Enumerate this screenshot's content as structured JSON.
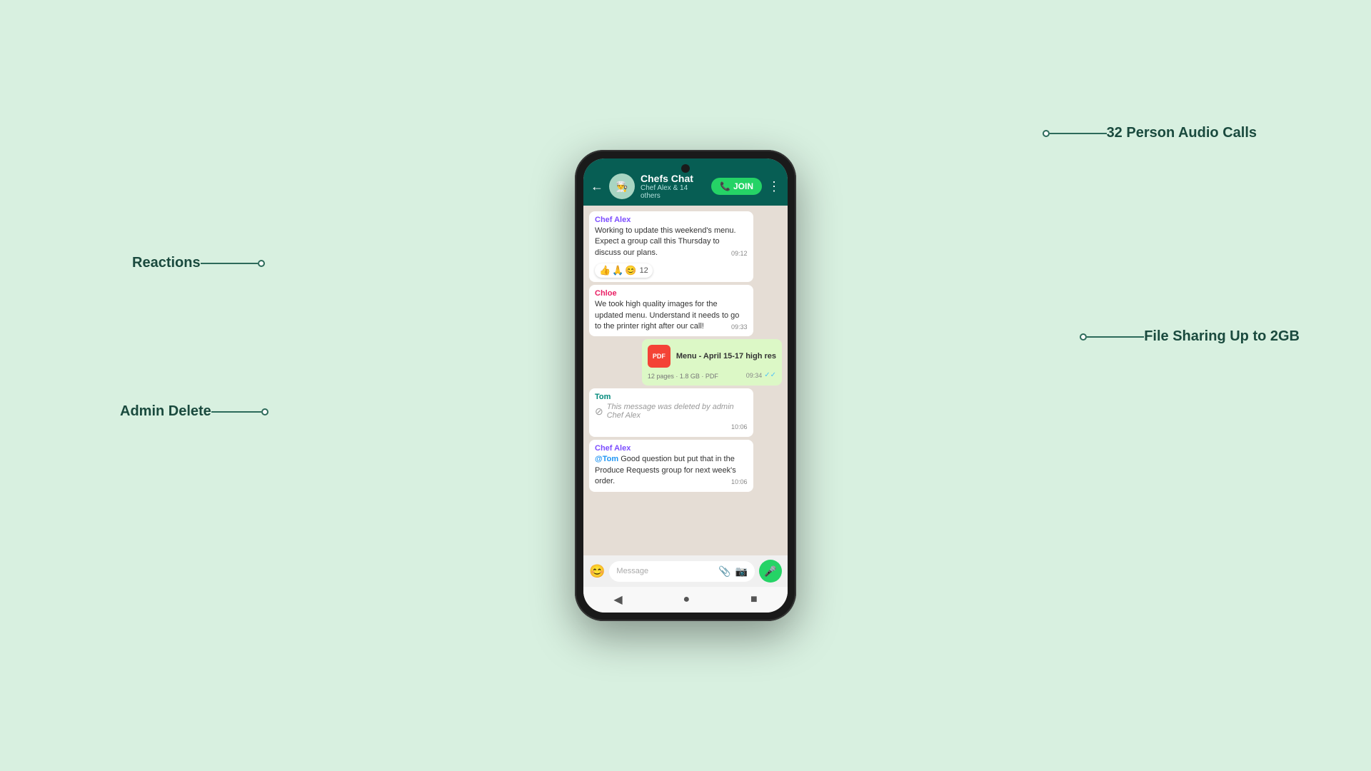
{
  "background_color": "#d8f0e0",
  "annotations": {
    "reactions": {
      "label": "Reactions"
    },
    "admin_delete": {
      "label": "Admin Delete"
    },
    "audio_calls": {
      "label": "32 Person Audio Calls"
    },
    "file_sharing": {
      "label": "File Sharing Up to 2GB"
    }
  },
  "chat": {
    "header": {
      "back_icon": "←",
      "group_name": "Chefs Chat",
      "subtitle": "Chef Alex & 14 others",
      "join_button": "JOIN",
      "more_icon": "⋮"
    },
    "messages": [
      {
        "id": "msg1",
        "type": "received",
        "sender": "Chef Alex",
        "sender_color": "alex",
        "text": "Working to update this weekend's menu. Expect a group call this Thursday to discuss our plans.",
        "time": "09:12",
        "reactions": {
          "emojis": [
            "👍",
            "🙏",
            "😊"
          ],
          "count": "12"
        }
      },
      {
        "id": "msg2",
        "type": "received",
        "sender": "Chloe",
        "sender_color": "chloe",
        "text": "We took high quality images for the updated menu. Understand it needs to go to the printer right after our call!",
        "time": "09:33"
      },
      {
        "id": "msg3",
        "type": "sent-file",
        "file_name": "Menu - April 15-17 high res",
        "file_icon": "PDF",
        "file_meta": "12 pages · 1.8 GB · PDF",
        "time": "09:34",
        "ticks": "✓✓"
      },
      {
        "id": "msg4",
        "type": "received",
        "sender": "Tom",
        "sender_color": "tom",
        "deleted": true,
        "deleted_text": "This message was deleted by admin Chef Alex",
        "time": "10:06"
      },
      {
        "id": "msg5",
        "type": "received",
        "sender": "Chef Alex",
        "sender_color": "alex",
        "mention": "@Tom",
        "text": " Good question but put that in the Produce Requests group for next week's order.",
        "time": "10:06"
      }
    ],
    "input": {
      "placeholder": "Message",
      "emoji_icon": "😊",
      "attach_icon": "📎",
      "camera_icon": "📷",
      "mic_icon": "🎤"
    },
    "nav": {
      "back_icon": "◀",
      "home_icon": "●",
      "square_icon": "■"
    }
  }
}
